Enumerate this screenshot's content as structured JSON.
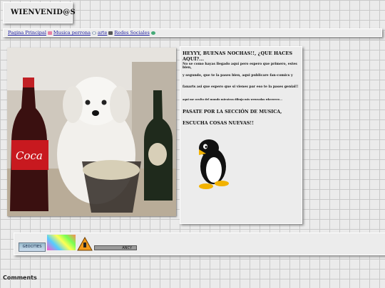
{
  "header": {
    "title": "WIENVENID@S"
  },
  "nav": {
    "items": [
      {
        "label": "Pagina Principal",
        "icon": "cake-icon"
      },
      {
        "label": "Musica perrona",
        "icon": "cd-icon"
      },
      {
        "label": "arte",
        "icon": "music-note-icon"
      },
      {
        "label": "Redes Sociales",
        "icon": "globe-icon"
      }
    ]
  },
  "content": {
    "photo": {
      "icon": "dog-with-coke-photo"
    },
    "paragraphs": [
      "HEYYY, BUENAS NOCHAS!!, ¿QUE HACES AQUÍ?...",
      "No se como hayas llegado aquí pero espero que primero, estes bien,",
      "y segundo, que te la pases bien, aqui publicare fan-comics y",
      "fanarts asi que espero que si vienes par eso te la pases genial!!",
      "aqui me oculto del mundo mientras dibujo mis weweadas wheeeeee...",
      "PASATE POR LA SECCIÓN DE MUSICA,",
      "ESCUCHA COSAS NUEVAS!!"
    ],
    "mascot": {
      "icon": "tux-penguin-icon"
    }
  },
  "badges": [
    {
      "label": "GEOCITIES",
      "icon": "geocities-badge"
    },
    {
      "label": "",
      "icon": "colorful-pixel-badge"
    },
    {
      "label": "",
      "icon": "construction-sign-icon"
    },
    {
      "label": "ANCY",
      "icon": "ancy-badge"
    }
  ],
  "footer": {
    "comments_label": "Comments"
  },
  "colors": {
    "link": "#1a1aa0",
    "panel": "#ececec",
    "grid": "#c9c9c9"
  }
}
